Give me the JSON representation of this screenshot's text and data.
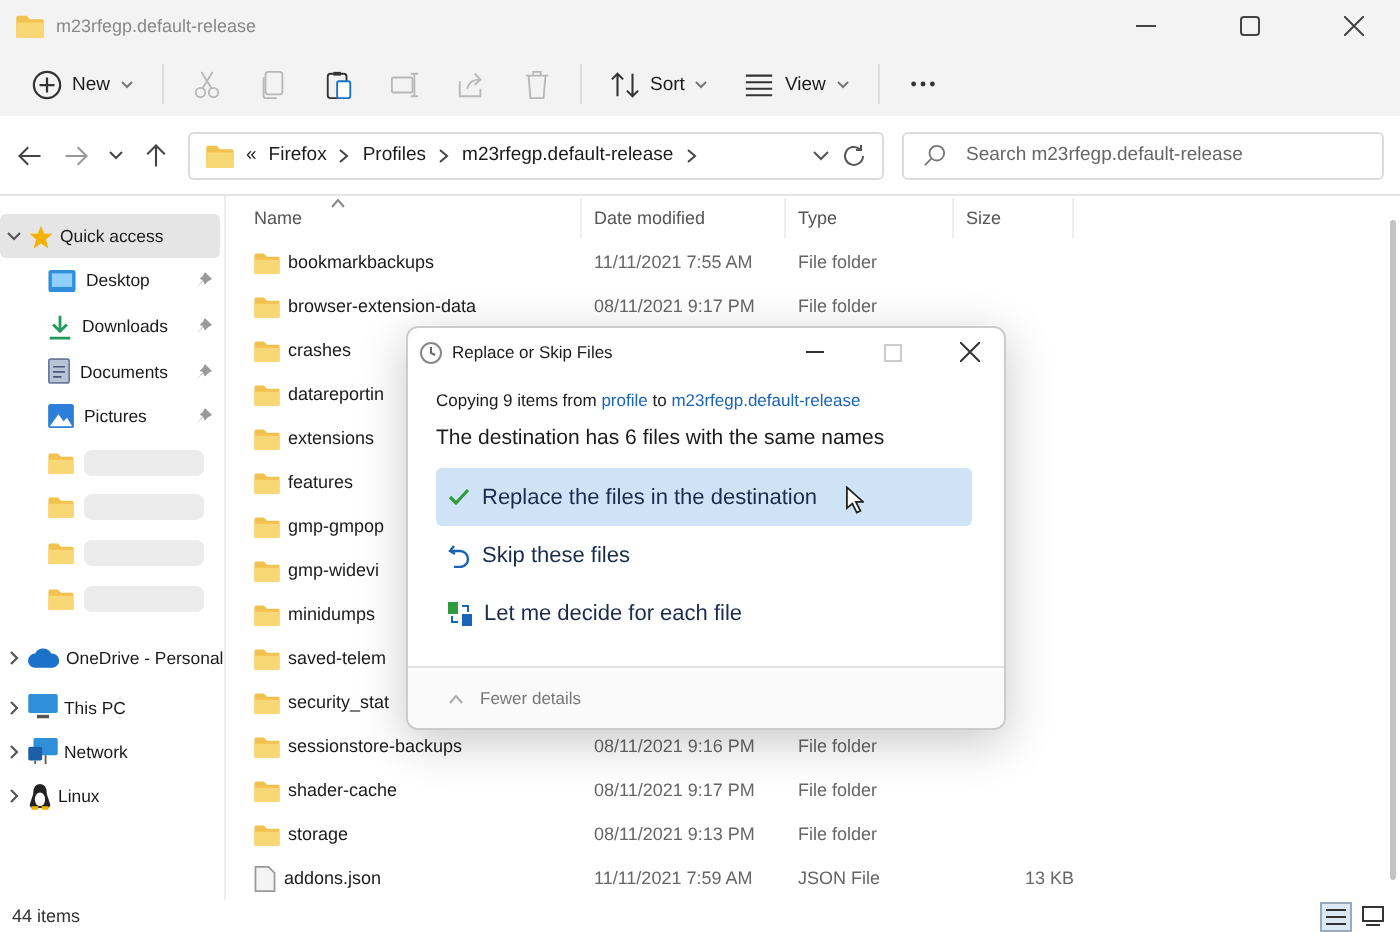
{
  "window": {
    "title": "m23rfegp.default-release"
  },
  "toolbar": [
    {
      "kind": "new",
      "label": "New",
      "disabled": false
    },
    {
      "kind": "cut",
      "disabled": true
    },
    {
      "kind": "copy",
      "disabled": true
    },
    {
      "kind": "paste",
      "disabled": false
    },
    {
      "kind": "rename",
      "disabled": true
    },
    {
      "kind": "share",
      "disabled": true
    },
    {
      "kind": "delete",
      "disabled": true
    },
    {
      "kind": "sort",
      "label": "Sort",
      "disabled": false
    },
    {
      "kind": "view",
      "label": "View",
      "disabled": false
    },
    {
      "kind": "more",
      "disabled": false
    }
  ],
  "address": {
    "overflow": "«",
    "crumbs": [
      "Firefox",
      "Profiles",
      "m23rfegp.default-release"
    ]
  },
  "search": {
    "placeholder": "Search m23rfegp.default-release"
  },
  "sidebar": {
    "items": [
      {
        "kind": "star",
        "label": "Quick access",
        "selected": true,
        "expanded": true,
        "children": [
          {
            "kind": "desktop",
            "label": "Desktop",
            "pinned": true
          },
          {
            "kind": "download",
            "label": "Downloads",
            "pinned": true
          },
          {
            "kind": "documents",
            "label": "Documents",
            "pinned": true
          },
          {
            "kind": "pictures",
            "label": "Pictures",
            "pinned": true
          },
          {
            "kind": "redacted",
            "pinned": false
          },
          {
            "kind": "redacted",
            "pinned": false
          },
          {
            "kind": "redacted",
            "pinned": false
          },
          {
            "kind": "redacted",
            "pinned": false
          }
        ]
      },
      {
        "kind": "cloud",
        "label": "OneDrive - Personal",
        "selected": false,
        "expanded": false
      },
      {
        "kind": "pc",
        "label": "This PC",
        "selected": false,
        "expanded": false
      },
      {
        "kind": "network",
        "label": "Network",
        "selected": false,
        "expanded": false
      },
      {
        "kind": "linux",
        "label": "Linux",
        "selected": false,
        "expanded": false
      }
    ]
  },
  "table": {
    "columns": [
      {
        "label": "Name",
        "sorted": true
      },
      {
        "label": "Date modified",
        "sorted": false
      },
      {
        "label": "Type",
        "sorted": false
      },
      {
        "label": "Size",
        "sorted": false
      }
    ],
    "rows": [
      {
        "kind": "folder",
        "name": "bookmarkbackups",
        "date": "11/11/2021 7:55 AM",
        "type": "File folder"
      },
      {
        "kind": "folder",
        "name": "browser-extension-data",
        "date": "08/11/2021 9:17 PM",
        "type": "File folder"
      },
      {
        "kind": "folder",
        "name": "crashes"
      },
      {
        "kind": "folder",
        "name": "datareportin"
      },
      {
        "kind": "folder",
        "name": "extensions"
      },
      {
        "kind": "folder",
        "name": "features"
      },
      {
        "kind": "folder",
        "name": "gmp-gmpop"
      },
      {
        "kind": "folder",
        "name": "gmp-widevi"
      },
      {
        "kind": "folder",
        "name": "minidumps"
      },
      {
        "kind": "folder",
        "name": "saved-telem"
      },
      {
        "kind": "folder",
        "name": "security_stat"
      },
      {
        "kind": "folder",
        "name": "sessionstore-backups",
        "date": "08/11/2021 9:16 PM",
        "type": "File folder"
      },
      {
        "kind": "folder",
        "name": "shader-cache",
        "date": "08/11/2021 9:17 PM",
        "type": "File folder"
      },
      {
        "kind": "folder",
        "name": "storage",
        "date": "08/11/2021 9:13 PM",
        "type": "File folder"
      },
      {
        "kind": "file",
        "name": "addons.json",
        "date": "11/11/2021 7:59 AM",
        "type": "JSON File",
        "size": "13 KB"
      }
    ]
  },
  "dialog": {
    "title": "Replace or Skip Files",
    "source_line": {
      "prefix": "Copying 9 items from",
      "source": "profile",
      "middle": "to",
      "destination": "m23rfegp.default-release"
    },
    "heading": "The destination has 6 files with the same names",
    "options": [
      {
        "kind": "replace",
        "label": "Replace the files in the destination",
        "selected": true
      },
      {
        "kind": "skip",
        "label": "Skip these files",
        "selected": false
      },
      {
        "kind": "decide",
        "label": "Let me decide for each file",
        "selected": false
      }
    ],
    "details_toggle": "Fewer details"
  },
  "status_bar": {
    "count": "44 items",
    "views": [
      {
        "kind": "details",
        "selected": true
      },
      {
        "kind": "tiles",
        "selected": false
      }
    ]
  }
}
